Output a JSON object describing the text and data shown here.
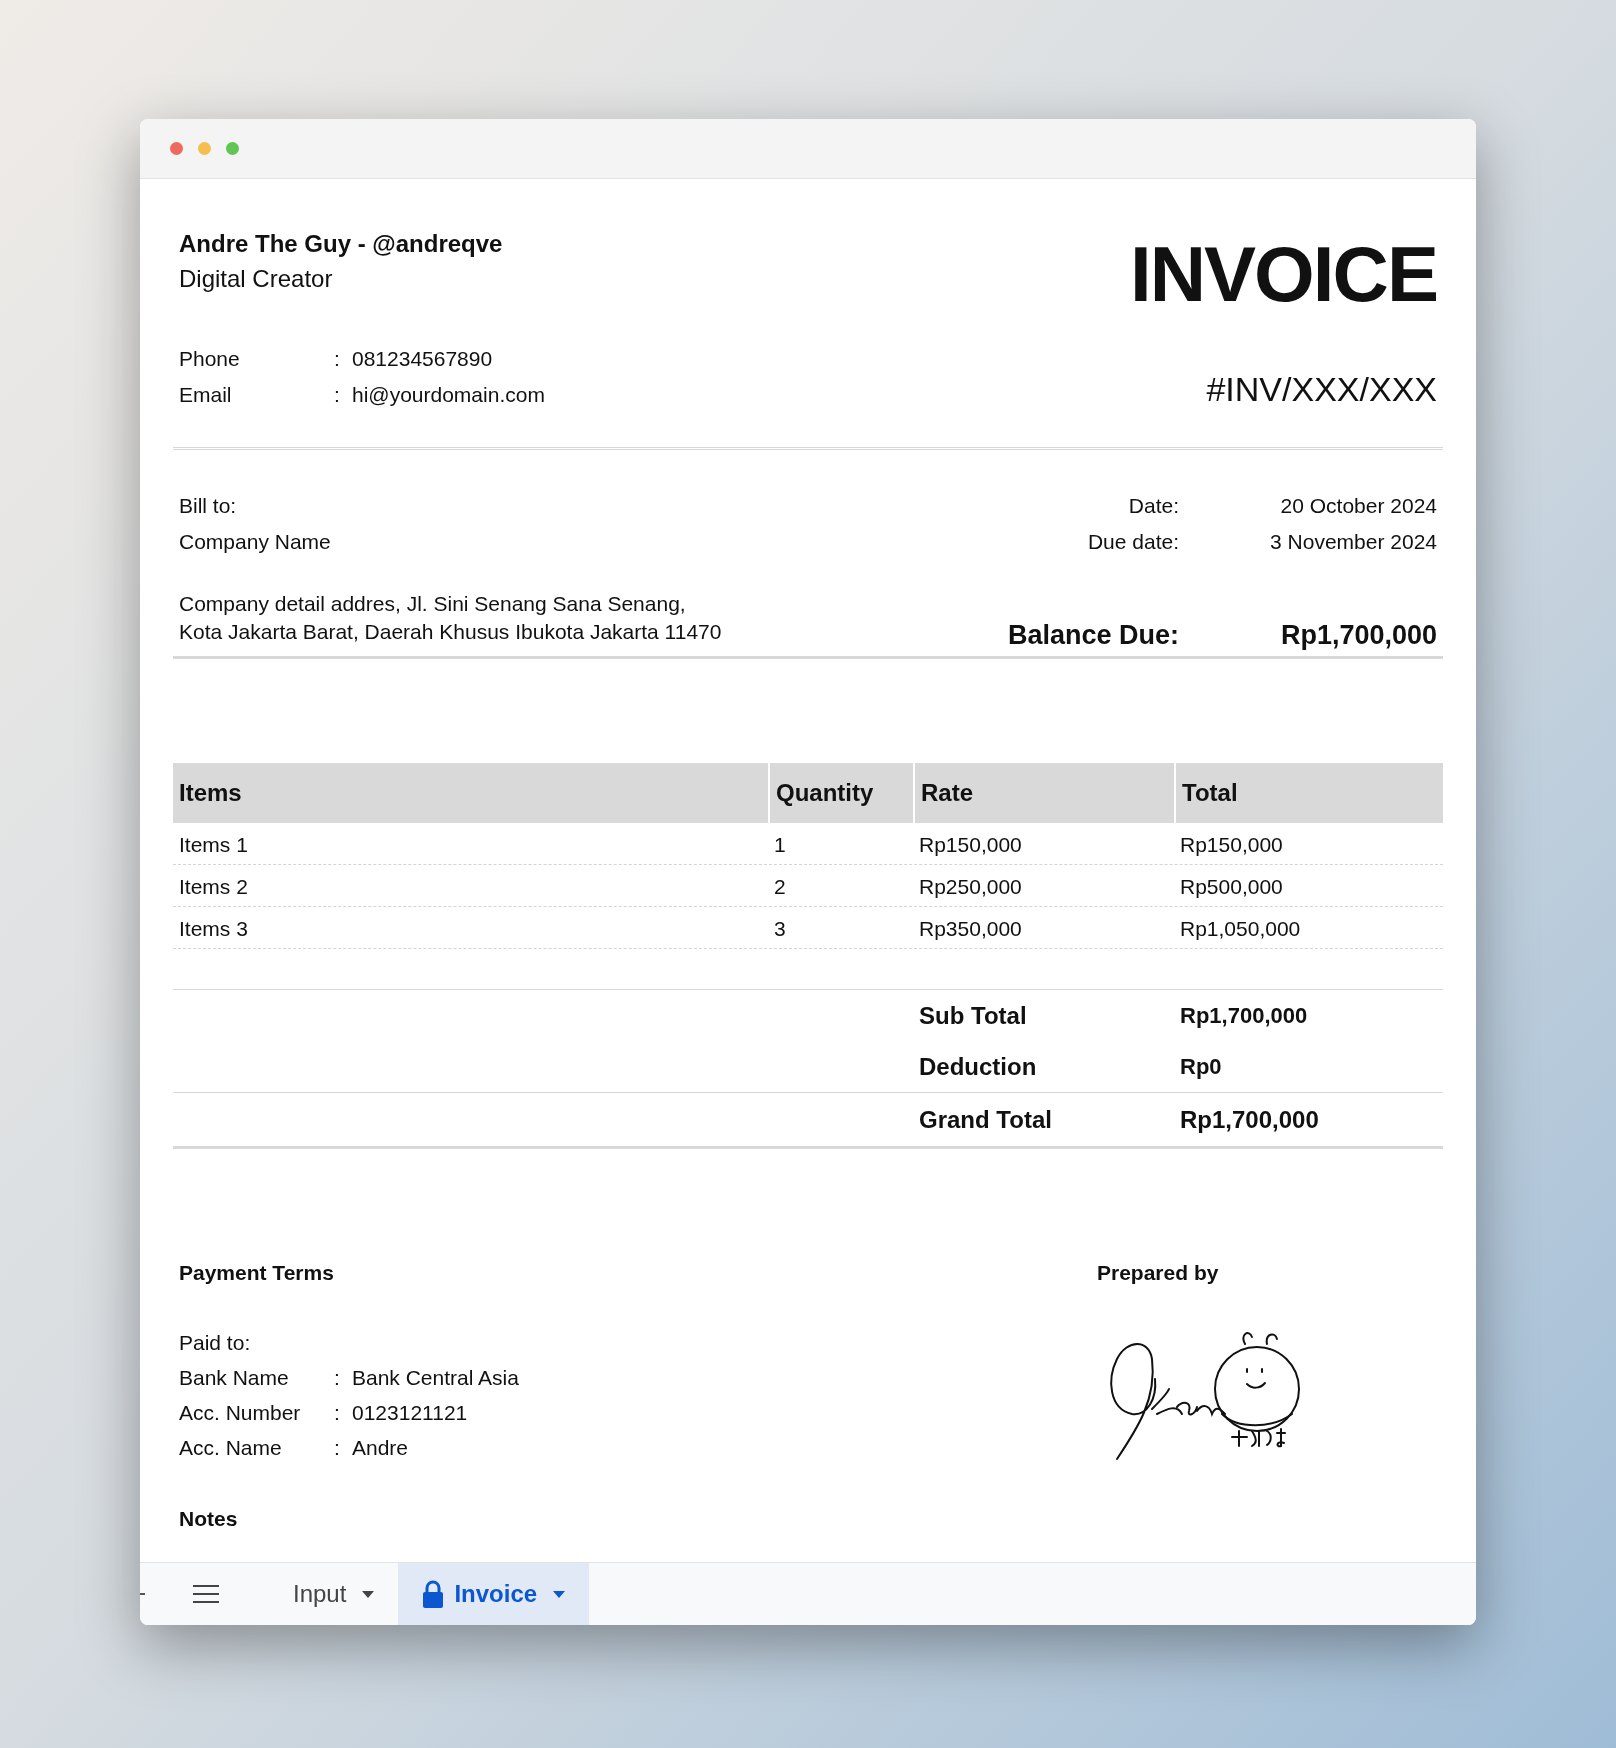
{
  "sender": {
    "name": "Andre The Guy - @andreqve",
    "role": "Digital Creator",
    "contacts": [
      {
        "label": "Phone",
        "separator": ":",
        "value": "081234567890"
      },
      {
        "label": "Email",
        "separator": ":",
        "value": "hi@yourdomain.com"
      }
    ]
  },
  "invoice": {
    "title": "INVOICE",
    "number": "#INV/XXX/XXX"
  },
  "bill_to": {
    "label": "Bill to:",
    "company": "Company Name",
    "address": [
      "Company detail addres, Jl. Sini Senang Sana Senang,",
      "Kota Jakarta Barat, Daerah Khusus Ibukota Jakarta 11470"
    ]
  },
  "dates": [
    {
      "label": "Date:",
      "value": "20 October 2024"
    },
    {
      "label": "Due date:",
      "value": "3 November 2024"
    }
  ],
  "balance_due": {
    "label": "Balance Due:",
    "value": "Rp1,700,000"
  },
  "table": {
    "columns": [
      "Items",
      "Quantity",
      "Rate",
      "Total"
    ],
    "rows": [
      [
        "Items 1",
        "1",
        "Rp150,000",
        "Rp150,000"
      ],
      [
        "Items 2",
        "2",
        "Rp250,000",
        "Rp500,000"
      ],
      [
        "Items 3",
        "3",
        "Rp350,000",
        "Rp1,050,000"
      ]
    ]
  },
  "totals": [
    {
      "label": "Sub Total",
      "value": "Rp1,700,000",
      "kind": "sub"
    },
    {
      "label": "Deduction",
      "value": "Rp0",
      "kind": "sub"
    },
    {
      "label": "Grand Total",
      "value": "Rp1,700,000",
      "kind": "grand"
    }
  ],
  "payment_terms": {
    "title": "Payment Terms",
    "paid_to": "Paid to:",
    "fields": [
      {
        "label": "Bank Name",
        "separator": ":",
        "value": "Bank Central Asia"
      },
      {
        "label": "Acc. Number",
        "separator": ":",
        "value": "0123121121"
      },
      {
        "label": "Acc. Name",
        "separator": ":",
        "value": "Andre"
      }
    ]
  },
  "notes": {
    "title": "Notes"
  },
  "prepared_by": {
    "title": "Prepared by"
  },
  "sheet_tabs": [
    {
      "label": "Input",
      "selected": false,
      "locked": false
    },
    {
      "label": "Invoice",
      "selected": true,
      "locked": true
    }
  ]
}
